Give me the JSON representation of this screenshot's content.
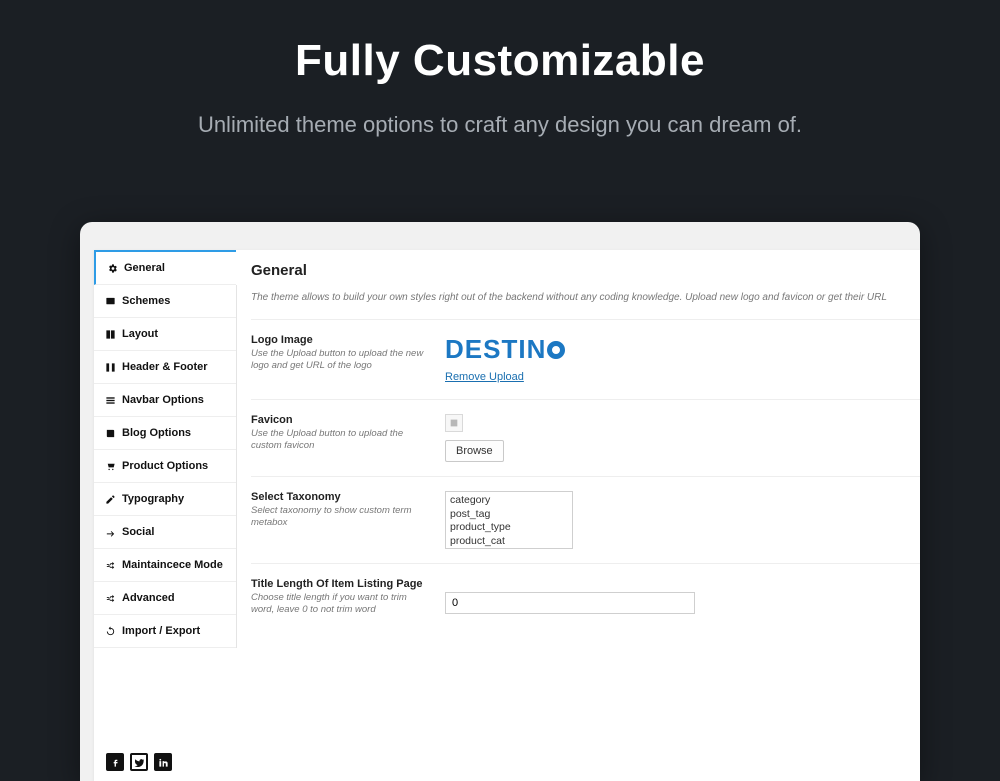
{
  "hero": {
    "title": "Fully Customizable",
    "subtitle": "Unlimited theme options to craft any design you can dream of."
  },
  "sidebar": {
    "items": [
      {
        "label": "General",
        "icon": "gear-icon",
        "active": true
      },
      {
        "label": "Schemes",
        "icon": "palette-icon",
        "active": false
      },
      {
        "label": "Layout",
        "icon": "layout-icon",
        "active": false
      },
      {
        "label": "Header & Footer",
        "icon": "header-icon",
        "active": false
      },
      {
        "label": "Navbar Options",
        "icon": "bars-icon",
        "active": false
      },
      {
        "label": "Blog Options",
        "icon": "book-icon",
        "active": false
      },
      {
        "label": "Product Options",
        "icon": "cart-icon",
        "active": false
      },
      {
        "label": "Typography",
        "icon": "edit-icon",
        "active": false
      },
      {
        "label": "Social",
        "icon": "share-icon",
        "active": false
      },
      {
        "label": "Maintaincece Mode",
        "icon": "shuffle-icon",
        "active": false
      },
      {
        "label": "Advanced",
        "icon": "shuffle-icon",
        "active": false
      },
      {
        "label": "Import / Export",
        "icon": "refresh-icon",
        "active": false
      }
    ]
  },
  "content": {
    "title": "General",
    "description": "The theme allows to build your own styles right out of the backend without any coding knowledge. Upload new logo and favicon or get their URL"
  },
  "fields": {
    "logo": {
      "title": "Logo Image",
      "hint": "Use the Upload button to upload the new logo and get URL of the logo",
      "logo_text": "DESTINO",
      "remove_label": "Remove Upload"
    },
    "favicon": {
      "title": "Favicon",
      "hint": "Use the Upload button to upload the custom favicon",
      "browse_label": "Browse"
    },
    "taxonomy": {
      "title": "Select Taxonomy",
      "hint": "Select taxonomy to show custom term metabox",
      "options": [
        "category",
        "post_tag",
        "product_type",
        "product_cat"
      ]
    },
    "title_length": {
      "title": "Title Length Of Item Listing Page",
      "hint": "Choose title length if you want to trim word, leave 0 to not trim word",
      "value": "0"
    }
  }
}
